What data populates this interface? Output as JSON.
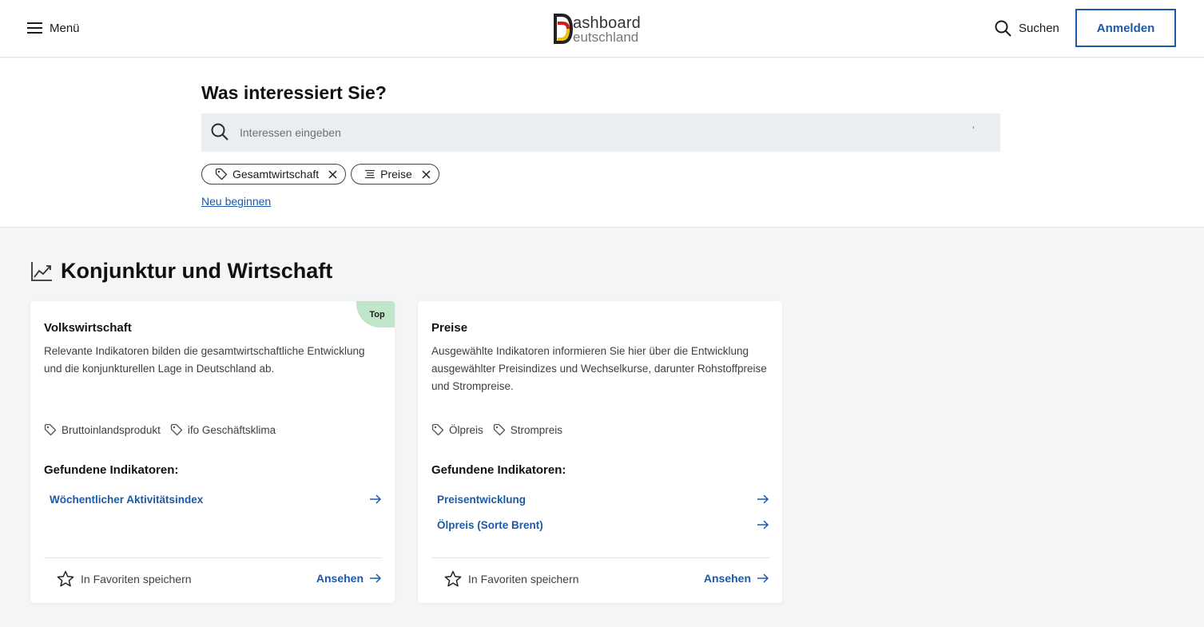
{
  "header": {
    "menu_label": "Menü",
    "logo_word1": "ashboard",
    "logo_word2": "eutschland",
    "search_label": "Suchen",
    "login_label": "Anmelden"
  },
  "search": {
    "title": "Was interessiert Sie?",
    "placeholder": "Interessen eingeben",
    "chips": [
      {
        "label": "Gesamtwirtschaft",
        "icon": "tag-icon"
      },
      {
        "label": "Preise",
        "icon": "filter-icon"
      }
    ],
    "restart_label": "Neu beginnen"
  },
  "section": {
    "title": "Konjunktur und Wirtschaft",
    "icon": "trend-chart-icon"
  },
  "cards": [
    {
      "badge": "Top",
      "title": "Volkswirtschaft",
      "description": "Relevante Indikatoren bilden die gesamtwirtschaftliche Entwicklung und die konjunkturellen Lage in Deutschland ab.",
      "tags": [
        "Bruttoinlandsprodukt",
        "ifo Geschäftsklima"
      ],
      "found_label": "Gefundene Indikatoren:",
      "indicators": [
        "Wöchentlicher Aktivitätsindex"
      ],
      "favorite_label": "In Favoriten speichern",
      "view_label": "Ansehen"
    },
    {
      "badge": "",
      "title": "Preise",
      "description": "Ausgewählte Indikatoren informieren Sie hier über die Entwicklung ausgewählter Preisindizes und Wechselkurse, darunter Rohstoffpreise und Strompreise.",
      "tags": [
        "Ölpreis",
        "Strompreis"
      ],
      "found_label": "Gefundene Indikatoren:",
      "indicators": [
        "Preisentwicklung",
        "Ölpreis (Sorte Brent)"
      ],
      "favorite_label": "In Favoriten speichern",
      "view_label": "Ansehen"
    }
  ],
  "colors": {
    "accent": "#1b5aa8",
    "badge_bg": "#bfe6c9",
    "page_bg": "#f4f5f6"
  }
}
